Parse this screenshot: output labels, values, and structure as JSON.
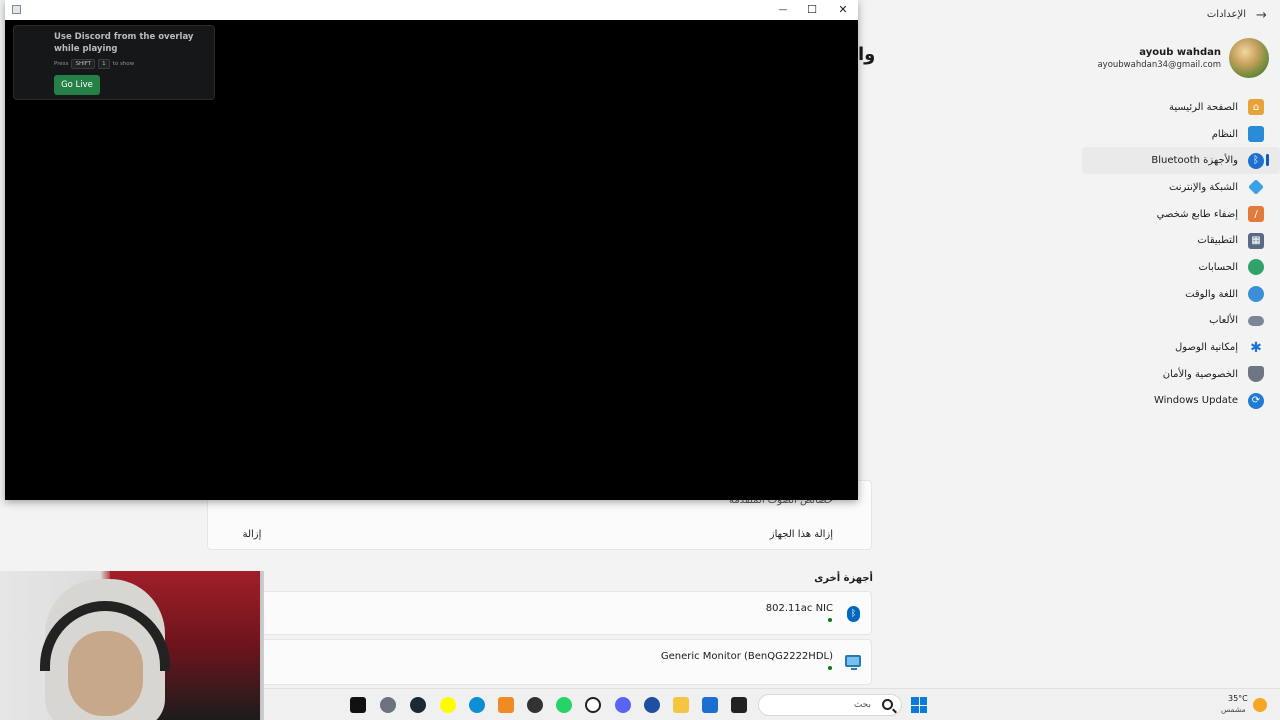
{
  "settings": {
    "title": "الإعدادات",
    "profile": {
      "name": "ayoub wahdan",
      "email": "ayoubwahdan34@gmail.com"
    },
    "nav": [
      {
        "label": "الصفحة الرئيسية",
        "icon": "home-icon",
        "color": "#e8a23a"
      },
      {
        "label": "النظام",
        "icon": "system-icon",
        "color": "#2a8bd6"
      },
      {
        "label": "Bluetooth والأجهزة",
        "icon": "bluetooth-icon",
        "color": "#1f6fcf"
      },
      {
        "label": "الشبكة والإنترنت",
        "icon": "network-icon",
        "color": "#3aa0e6"
      },
      {
        "label": "إضفاء طابع شخصي",
        "icon": "brush-icon",
        "color": "#e07b39"
      },
      {
        "label": "التطبيقات",
        "icon": "apps-icon",
        "color": "#5a6a86"
      },
      {
        "label": "الحسابات",
        "icon": "accounts-icon",
        "color": "#2fa36b"
      },
      {
        "label": "اللغة والوقت",
        "icon": "globe-icon",
        "color": "#3b8fd8"
      },
      {
        "label": "الألعاب",
        "icon": "gamepad-icon",
        "color": "#7d8694"
      },
      {
        "label": "إمكانية الوصول",
        "icon": "accessibility-icon",
        "color": "#1c74d6"
      },
      {
        "label": "الخصوصية والأمان",
        "icon": "shield-icon",
        "color": "#6e7681"
      },
      {
        "label": "Windows Update",
        "icon": "update-icon",
        "color": "#1f7bd6"
      }
    ],
    "active_nav_index": 2,
    "page_title_partial": "وا",
    "remove_device_label": "إزالة هذا الجهاز",
    "remove_button": "إزالة",
    "advanced_audio_partial": "خصائص الصوت المتقدمة",
    "other_devices_heading": "أجهزة أخرى",
    "devices": [
      {
        "name": "802.11ac NIC",
        "icon": "bluetooth-icon"
      },
      {
        "name": "Generic Monitor (BenQG2222HDL)",
        "icon": "monitor-icon"
      }
    ]
  },
  "overlay": {
    "title": "Use Discord from the overlay while playing",
    "hint_press": "Press",
    "hint_key1": "SHIFT",
    "hint_key2": "1",
    "hint_to_show": "to show",
    "go_live": "Go Live"
  },
  "window_controls": {
    "minimize": "—",
    "maximize": "☐",
    "close": "✕"
  },
  "taskbar": {
    "search_placeholder": "بحث",
    "weather_temp": "35°C",
    "weather_desc": "مشمس",
    "apps": [
      "skate-icon",
      "settings-icon",
      "steam-icon",
      "snapchat-icon",
      "edge-icon",
      "fl-icon",
      "chess-icon",
      "whatsapp-icon",
      "chatgpt-icon",
      "discord-icon",
      "vpn-icon",
      "folder-icon",
      "store-icon",
      "terminal-icon"
    ]
  }
}
